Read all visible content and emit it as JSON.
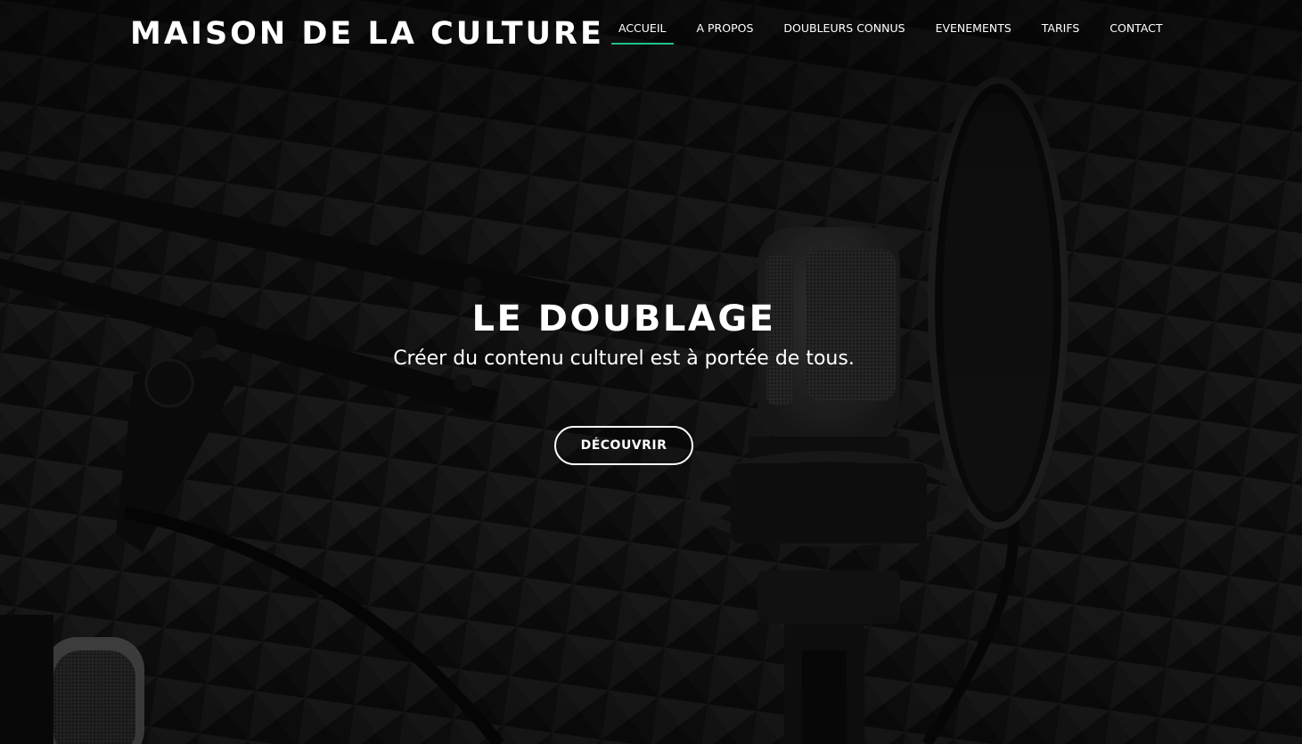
{
  "header": {
    "logo_text": "MAISON DE LA CULTURE",
    "nav": {
      "items": [
        {
          "label": "ACCUEIL",
          "active": true
        },
        {
          "label": "A PROPOS",
          "active": false
        },
        {
          "label": "DOUBLEURS CONNUS",
          "active": false
        },
        {
          "label": "EVENEMENTS",
          "active": false
        },
        {
          "label": "TARIFS",
          "active": false
        },
        {
          "label": "CONTACT",
          "active": false
        }
      ]
    }
  },
  "hero": {
    "title": "LE DOUBLAGE",
    "subtitle": "Créer du contenu culturel est à portée de tous.",
    "cta_label": "DÉCOUVRIR",
    "background_icon": "studio-microphone-icon"
  },
  "colors": {
    "accent": "#1fc28e",
    "text": "#ffffff",
    "background": "#0b0b0b"
  }
}
